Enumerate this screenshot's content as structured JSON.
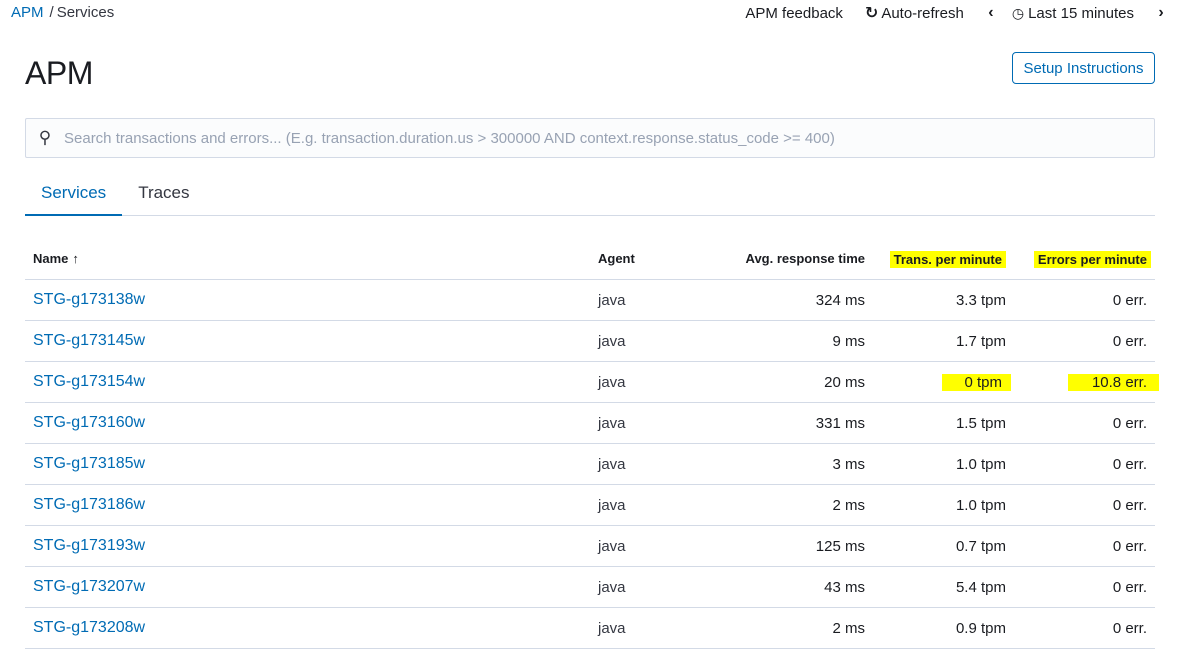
{
  "breadcrumb": {
    "root": "APM",
    "separator": "/",
    "current": "Services"
  },
  "top_actions": {
    "feedback": "APM feedback",
    "auto_refresh": "Auto-refresh",
    "time_range": "Last 15 minutes"
  },
  "page": {
    "title": "APM",
    "setup_button": "Setup Instructions"
  },
  "search": {
    "placeholder": "Search transactions and errors... (E.g. transaction.duration.us > 300000 AND context.response.status_code >= 400)",
    "value": ""
  },
  "tabs": [
    {
      "label": "Services"
    },
    {
      "label": "Traces"
    }
  ],
  "table": {
    "columns": {
      "name": "Name",
      "agent": "Agent",
      "avg_response": "Avg. response time",
      "tpm": "Trans. per minute",
      "epm": "Errors per minute"
    },
    "rows": [
      {
        "name": "STG-g173138w",
        "agent": "java",
        "response": "324 ms",
        "tpm": "3.3 tpm",
        "epm": "0 err."
      },
      {
        "name": "STG-g173145w",
        "agent": "java",
        "response": "9 ms",
        "tpm": "1.7 tpm",
        "epm": "0 err."
      },
      {
        "name": "STG-g173154w",
        "agent": "java",
        "response": "20 ms",
        "tpm": "0 tpm",
        "epm": "10.8 err."
      },
      {
        "name": "STG-g173160w",
        "agent": "java",
        "response": "331 ms",
        "tpm": "1.5 tpm",
        "epm": "0 err."
      },
      {
        "name": "STG-g173185w",
        "agent": "java",
        "response": "3 ms",
        "tpm": "1.0 tpm",
        "epm": "0 err."
      },
      {
        "name": "STG-g173186w",
        "agent": "java",
        "response": "2 ms",
        "tpm": "1.0 tpm",
        "epm": "0 err."
      },
      {
        "name": "STG-g173193w",
        "agent": "java",
        "response": "125 ms",
        "tpm": "0.7 tpm",
        "epm": "0 err."
      },
      {
        "name": "STG-g173207w",
        "agent": "java",
        "response": "43 ms",
        "tpm": "5.4 tpm",
        "epm": "0 err."
      },
      {
        "name": "STG-g173208w",
        "agent": "java",
        "response": "2 ms",
        "tpm": "0.9 tpm",
        "epm": "0 err."
      }
    ]
  },
  "colors": {
    "link": "#006bb4",
    "highlight": "#ffff00",
    "border": "#d3dae6"
  },
  "icons": {
    "refresh": "refresh-icon",
    "clock": "clock-icon",
    "search": "search-icon",
    "sort": "sort-up-icon"
  }
}
